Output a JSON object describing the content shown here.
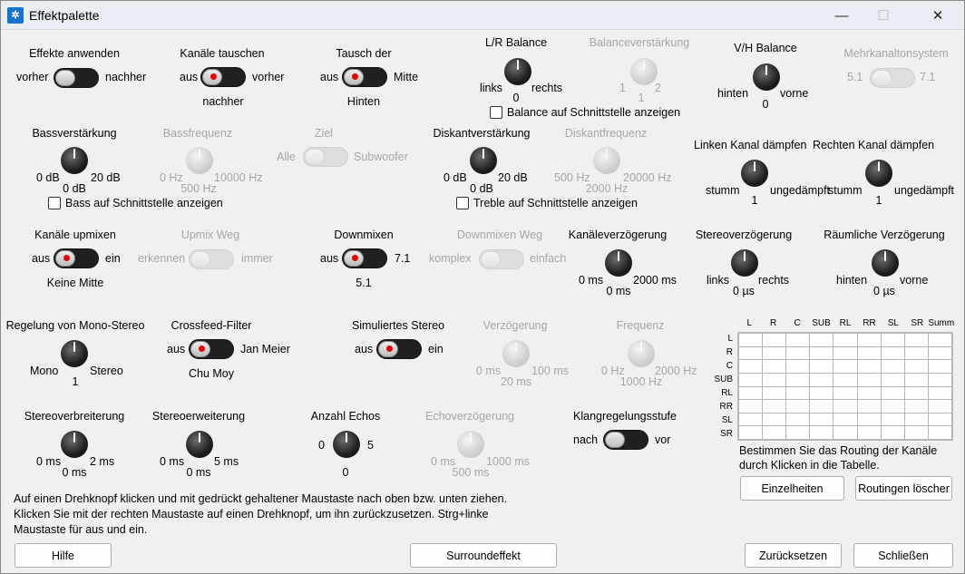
{
  "window": {
    "title": "Effektpalette",
    "app_icon": "app-logo-icon",
    "min_icon": "minimize-icon",
    "max_icon": "maximize-icon",
    "close_icon": "close-icon"
  },
  "controls": {
    "effekte": {
      "label": "Effekte anwenden",
      "left": "vorher",
      "right": "nachher"
    },
    "kanaele_tauschen": {
      "label": "Kanäle tauschen",
      "left": "aus",
      "right": "vorher",
      "value": "nachher"
    },
    "tausch": {
      "label": "Tausch der",
      "left": "aus",
      "right": "Mitte",
      "value": "Hinten"
    },
    "lr_balance": {
      "label": "L/R Balance",
      "left": "links",
      "right": "rechts",
      "value": "0"
    },
    "balanceverst": {
      "label": "Balanceverstärkung",
      "left": "1",
      "right": "2",
      "value": "1"
    },
    "balance_chk": {
      "label": "Balance auf Schnittstelle anzeigen"
    },
    "vh_balance": {
      "label": "V/H Balance",
      "left": "hinten",
      "right": "vorne",
      "value": "0"
    },
    "mehrkanal": {
      "label": "Mehrkanaltonsystem",
      "left": "5.1",
      "right": "7.1"
    },
    "bass": {
      "label": "Bassverstärkung",
      "left": "0 dB",
      "right": "20 dB",
      "value": "0 dB"
    },
    "bassfreq": {
      "label": "Bassfrequenz",
      "left": "0 Hz",
      "right": "10000 Hz",
      "value": "500 Hz"
    },
    "ziel": {
      "label": "Ziel",
      "left": "Alle",
      "right": "Subwoofer"
    },
    "bass_chk": {
      "label": "Bass auf Schnittstelle anzeigen"
    },
    "diskant": {
      "label": "Diskantverstärkung",
      "left": "0 dB",
      "right": "20 dB",
      "value": "0 dB"
    },
    "diskantfreq": {
      "label": "Diskantfrequenz",
      "left": "500 Hz",
      "right": "20000 Hz",
      "value": "2000 Hz"
    },
    "treble_chk": {
      "label": "Treble auf Schnittstelle anzeigen"
    },
    "linken": {
      "label": "Linken Kanal dämpfen",
      "left": "stumm",
      "right": "ungedämpft",
      "value": "1"
    },
    "rechten": {
      "label": "Rechten Kanal dämpfen",
      "left": "stumm",
      "right": "ungedämpft",
      "value": "1"
    },
    "upmix": {
      "label": "Kanäle upmixen",
      "left": "aus",
      "right": "ein",
      "value": "Keine Mitte"
    },
    "upmix_weg": {
      "label": "Upmix Weg",
      "left": "erkennen",
      "right": "immer"
    },
    "downmix": {
      "label": "Downmixen",
      "left": "aus",
      "right": "7.1",
      "value": "5.1"
    },
    "downmix_weg": {
      "label": "Downmixen Weg",
      "left": "komplex",
      "right": "einfach"
    },
    "kanalverz": {
      "label": "Kanäleverzögerung",
      "left": "0 ms",
      "right": "2000 ms",
      "value": "0 ms"
    },
    "stereoverz": {
      "label": "Stereoverzögerung",
      "left": "links",
      "right": "rechts",
      "value": "0 µs"
    },
    "raeumlich": {
      "label": "Räumliche Verzögerung",
      "left": "hinten",
      "right": "vorne",
      "value": "0 µs"
    },
    "monostereo": {
      "label": "Regelung von Mono-Stereo",
      "left": "Mono",
      "right": "Stereo",
      "value": "1"
    },
    "crossfeed": {
      "label": "Crossfeed-Filter",
      "left": "aus",
      "right": "Jan Meier",
      "value": "Chu Moy"
    },
    "simstereo": {
      "label": "Simuliertes Stereo",
      "left": "aus",
      "right": "ein"
    },
    "verzoegerung": {
      "label": "Verzögerung",
      "left": "0 ms",
      "right": "100 ms",
      "value": "20 ms"
    },
    "frequenz": {
      "label": "Frequenz",
      "left": "0 Hz",
      "right": "2000 Hz",
      "value": "1000 Hz"
    },
    "stereoverbr": {
      "label": "Stereoverbreiterung",
      "left": "0 ms",
      "right": "2 ms",
      "value": "0 ms"
    },
    "stereoerw": {
      "label": "Stereoerweiterung",
      "left": "0 ms",
      "right": "5 ms",
      "value": "0 ms"
    },
    "echos": {
      "label": "Anzahl Echos",
      "left": "0",
      "right": "5",
      "value": "0"
    },
    "echoverz": {
      "label": "Echoverzögerung",
      "left": "0 ms",
      "right": "1000 ms",
      "value": "500 ms"
    },
    "klangstufe": {
      "label": "Klangregelungsstufe",
      "left": "nach",
      "right": "vor"
    }
  },
  "routing": {
    "cols": [
      "L",
      "R",
      "C",
      "SUB",
      "RL",
      "RR",
      "SL",
      "SR",
      "Summ"
    ],
    "rows": [
      "L",
      "R",
      "C",
      "SUB",
      "RL",
      "RR",
      "SL",
      "SR"
    ],
    "hint": "Bestimmen Sie das Routing der Kanäle",
    "hint2": "durch Klicken in die Tabelle.",
    "details_btn": "Einzelheiten",
    "clear_btn": "Routingen löscher"
  },
  "help_text": [
    "Auf einen Drehknopf klicken und mit gedrückt gehaltener Maustaste nach oben bzw. unten ziehen.",
    "Klicken Sie mit der rechten Maustaste auf einen Drehknopf, um ihn zurückzusetzen. Strg+linke",
    "Maustaste für aus und ein."
  ],
  "buttons": {
    "hilfe": "Hilfe",
    "surround": "Surroundeffekt",
    "reset": "Zurücksetzen",
    "close": "Schließen"
  },
  "colors": {
    "accent": "#1a73c8",
    "toggle_dot": "#e00000"
  }
}
